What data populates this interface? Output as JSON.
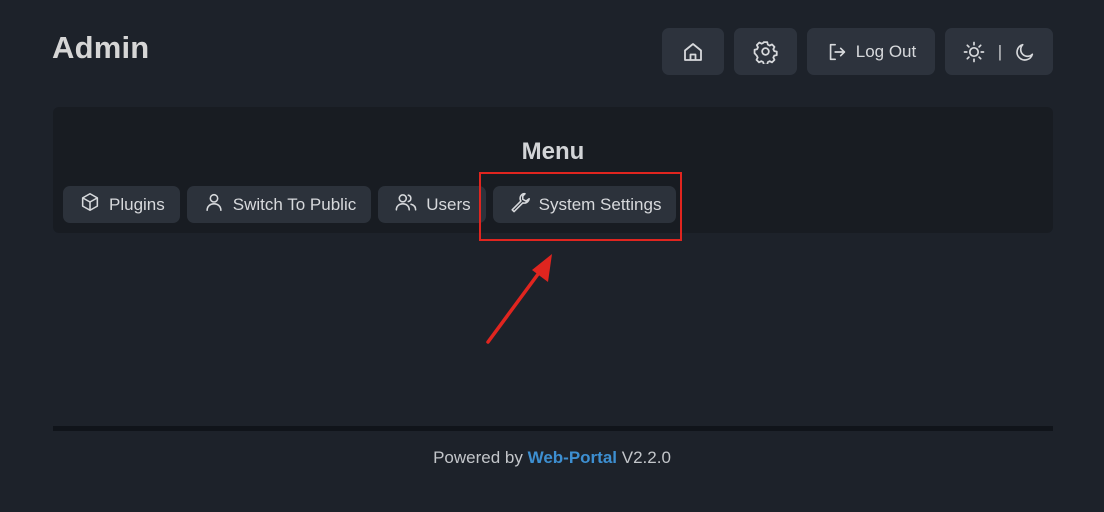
{
  "header": {
    "title": "Admin",
    "logout_label": "Log Out",
    "theme_separator": "|",
    "icons": [
      "home-icon",
      "gear-icon",
      "logout-icon",
      "sun-icon",
      "moon-icon"
    ]
  },
  "menu": {
    "title": "Menu",
    "items": [
      {
        "label": "Plugins",
        "icon": "cube-icon"
      },
      {
        "label": "Switch To Public",
        "icon": "user-icon"
      },
      {
        "label": "Users",
        "icon": "users-icon"
      },
      {
        "label": "System Settings",
        "icon": "wrench-icon"
      }
    ]
  },
  "annotation": {
    "highlight_color": "#e0251f",
    "highlighted_item": "System Settings"
  },
  "footer": {
    "prefix": "Powered by",
    "brand": "Web-Portal",
    "version": "V2.2.0",
    "brand_color": "#3d8fd1"
  }
}
